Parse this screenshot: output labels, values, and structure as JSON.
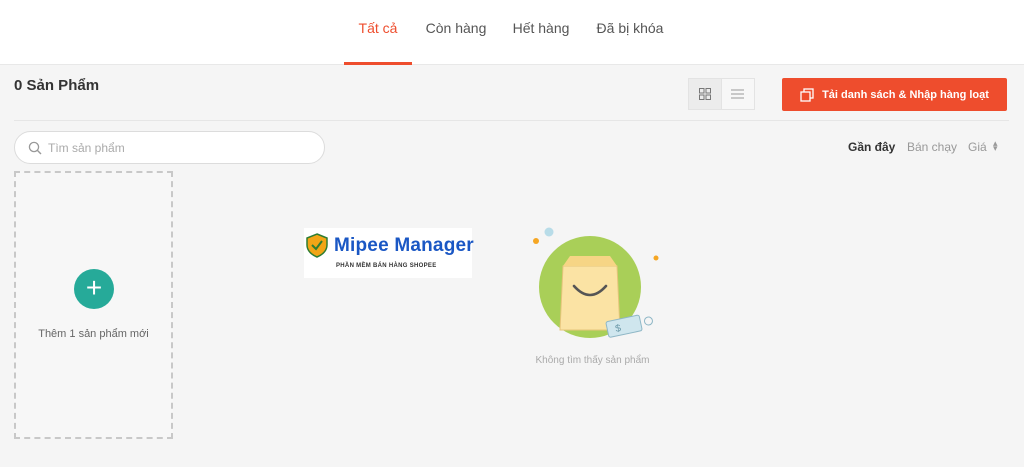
{
  "tabs": [
    {
      "label": "Tất cả",
      "active": true
    },
    {
      "label": "Còn hàng",
      "active": false
    },
    {
      "label": "Hết hàng",
      "active": false
    },
    {
      "label": "Đã bị khóa",
      "active": false
    }
  ],
  "product_count": "0 Sản Phẩm",
  "view_toggle": {
    "options": [
      "grid-icon",
      "list-icon"
    ],
    "selected": "grid-icon"
  },
  "bulk_button": {
    "label": "Tải danh sách & Nhập hàng loạt",
    "icon": "copy-icon"
  },
  "search": {
    "placeholder": "Tìm sản phẩm",
    "value": ""
  },
  "sort": [
    {
      "label": "Gần đây",
      "active": true
    },
    {
      "label": "Bán chạy",
      "active": false
    },
    {
      "label": "Giá",
      "active": false
    }
  ],
  "add_card": {
    "label": "Thêm 1 sản phẩm mới",
    "icon": "plus-icon"
  },
  "watermark": {
    "title": "Mipee Manager",
    "subtitle": "PHẦN MỀM BÁN HÀNG SHOPEE"
  },
  "empty_state": {
    "text": "Không tìm thấy sản phẩm",
    "icon": "empty-bag-icon"
  },
  "colors": {
    "accent": "#ee4d2d",
    "add_button": "#26aa99",
    "background": "#f5f5f5"
  }
}
